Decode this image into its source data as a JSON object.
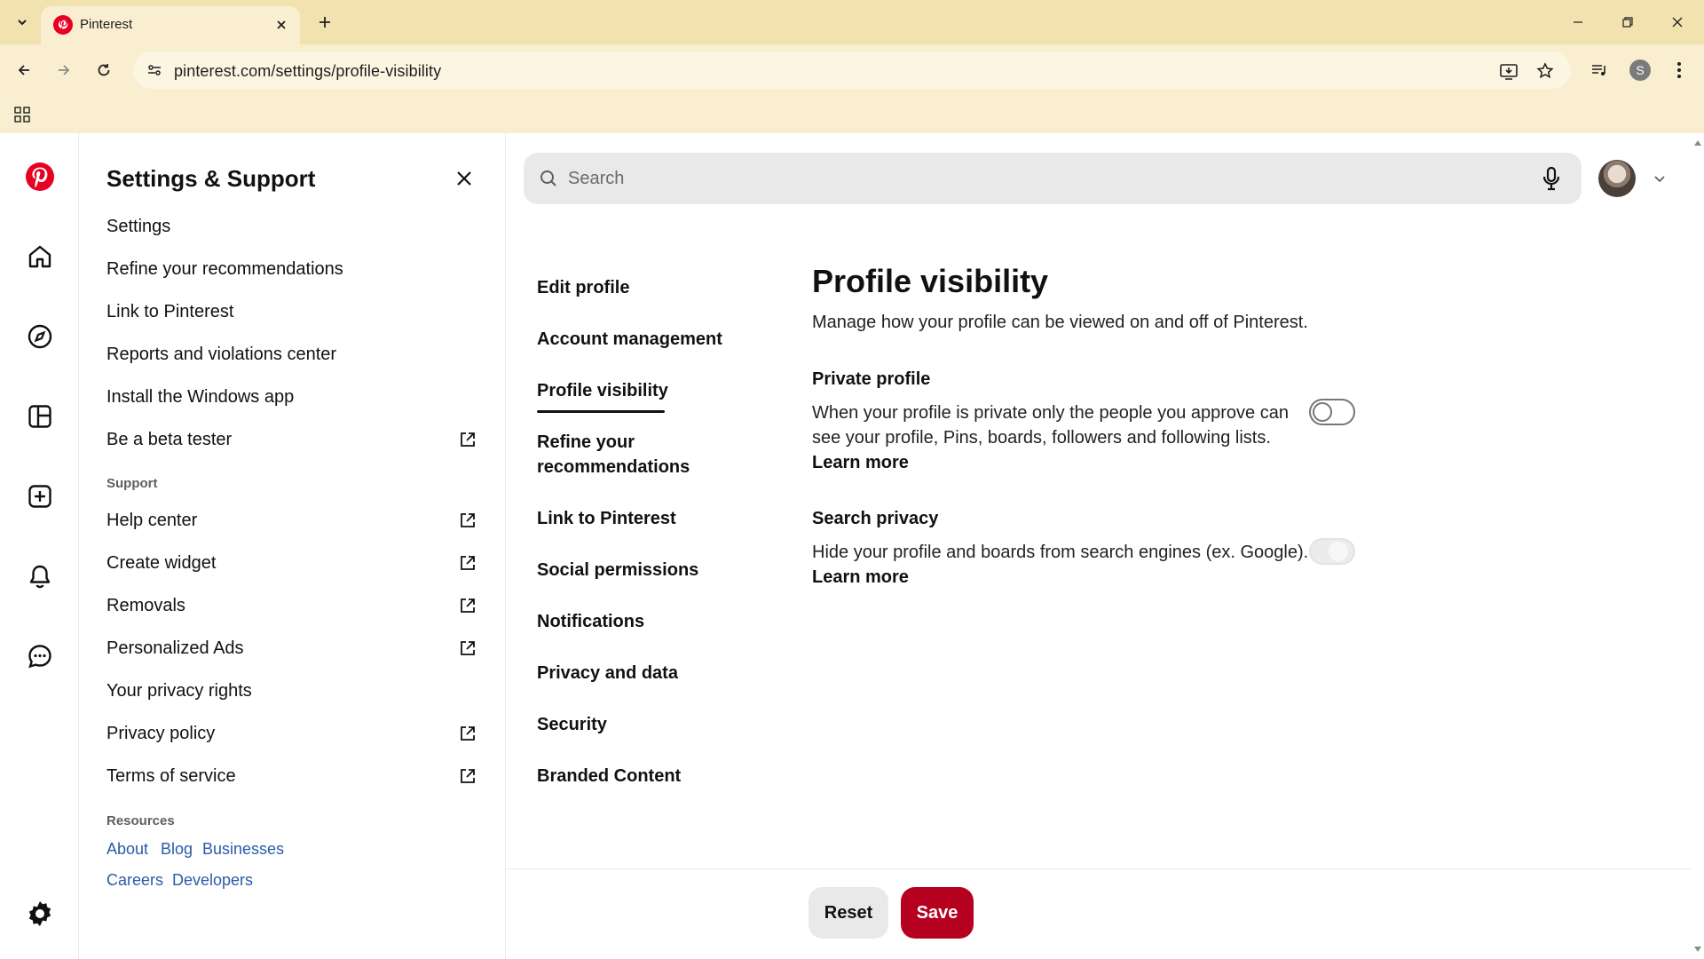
{
  "browser": {
    "tab_title": "Pinterest",
    "url": "pinterest.com/settings/profile-visibility",
    "profile_initial": "S"
  },
  "panel": {
    "title": "Settings & Support",
    "items": [
      {
        "label": "Settings"
      },
      {
        "label": "Refine your recommendations"
      },
      {
        "label": "Link to Pinterest"
      },
      {
        "label": "Reports and violations center"
      },
      {
        "label": "Install the Windows app"
      },
      {
        "label": "Be a beta tester"
      }
    ],
    "support_label": "Support",
    "support_items": [
      {
        "label": "Help center"
      },
      {
        "label": "Create widget"
      },
      {
        "label": "Removals"
      },
      {
        "label": "Personalized Ads"
      },
      {
        "label": "Your privacy rights"
      },
      {
        "label": "Privacy policy"
      },
      {
        "label": "Terms of service"
      }
    ],
    "resources_label": "Resources",
    "resources": [
      "About",
      "Blog",
      "Businesses",
      "Careers",
      "Developers"
    ]
  },
  "main": {
    "search_placeholder": "Search",
    "subnav": [
      "Edit profile",
      "Account management",
      "Profile visibility",
      "Refine your recommendations",
      "Link to Pinterest",
      "Social permissions",
      "Notifications",
      "Privacy and data",
      "Security",
      "Branded Content"
    ],
    "active_subnav": "Profile visibility",
    "title": "Profile visibility",
    "subtitle": "Manage how your profile can be viewed on and off of Pinterest.",
    "private_profile": {
      "heading": "Private profile",
      "description": "When your profile is private only the people you approve can see your profile, Pins, boards, followers and following lists.",
      "link": "Learn more",
      "enabled": false
    },
    "search_privacy": {
      "heading": "Search privacy",
      "description": "Hide your profile and boards from search engines (ex. Google).",
      "link": "Learn more",
      "enabled": false,
      "disabled": true
    },
    "reset_label": "Reset",
    "save_label": "Save"
  },
  "colors": {
    "brand_red": "#e60023",
    "save_button": "#b60020",
    "chrome_bg": "#f9efd0",
    "link_blue": "#2a5aa8"
  },
  "icons": [
    "pinterest-logo-icon",
    "home-icon",
    "explore-icon",
    "boards-icon",
    "create-icon",
    "notifications-icon",
    "messages-icon",
    "settings-gear-icon",
    "search-icon",
    "microphone-icon",
    "external-link-icon",
    "close-icon"
  ]
}
